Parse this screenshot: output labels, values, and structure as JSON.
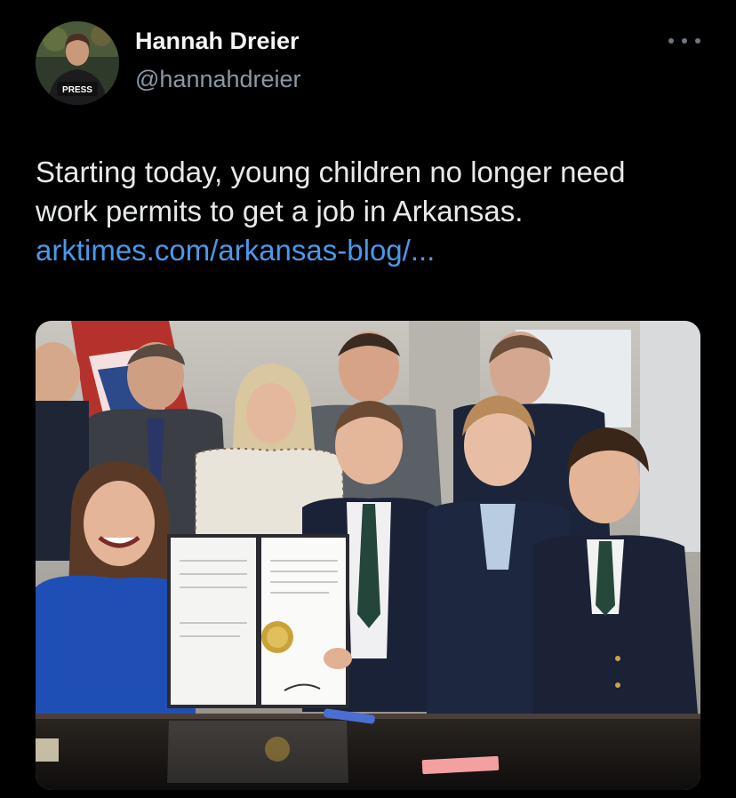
{
  "author": {
    "display_name": "Hannah Dreier",
    "handle": "@hannahdreier",
    "avatar_badge": "PRESS"
  },
  "tweet": {
    "text_line1": "Starting today, young children no longer need",
    "text_line2": "work permits to get a job in Arkansas.",
    "link_text": "arktimes.com/arkansas-blog/..."
  },
  "media": {
    "kind": "photo",
    "subject": "bill signing with adults and children around a desk"
  },
  "colors": {
    "background": "#000000",
    "text": "#e7e9ea",
    "secondary": "#8b98a5",
    "link": "#4a99e9"
  }
}
